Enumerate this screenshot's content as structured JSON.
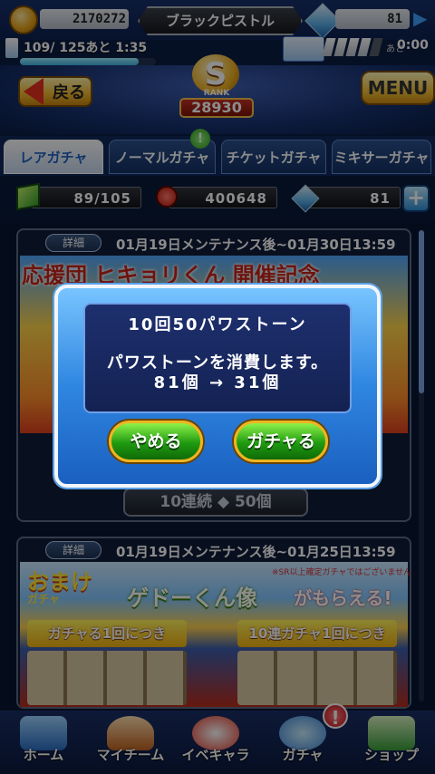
{
  "status": {
    "coins": "2170272",
    "nickname": "ブラックピストル",
    "stones": "81",
    "stamina_text": "109/ 125あと 1:35",
    "stamina_fraction": 0.872,
    "recover_prefix": "あと",
    "recover_time": "0:00",
    "energy_segments_on": 4,
    "energy_segments_total": 5
  },
  "header": {
    "back_label": "戻る",
    "rank_letter": "S",
    "rank_word": "RANK",
    "rank_value": "28930",
    "menu_label": "MENU"
  },
  "tabs": [
    {
      "label": "レアガチャ",
      "active": true
    },
    {
      "label": "ノーマルガチャ",
      "active": false
    },
    {
      "label": "チケットガチャ",
      "active": false
    },
    {
      "label": "ミキサーガチャ",
      "active": false
    }
  ],
  "notice_badge": "!",
  "resources": {
    "material": "89/105",
    "coin": "400648",
    "stone": "81",
    "plus": "+"
  },
  "banners": [
    {
      "detail": "詳細",
      "period": "01月19日メンテナンス後~01月30日13:59",
      "title": "応援団 ヒキョリくん 開催記念",
      "ten_roll": "10連続 ◆ 50個"
    },
    {
      "detail": "詳細",
      "period": "01月19日メンテナンス後~01月25日13:59",
      "omake": "おまけ",
      "gacha": "ガチャ",
      "title": "ゲドーくん像",
      "moraeru": "がもらえる!",
      "note": "※SR以上確定ガチャではございません",
      "box1": "ガチャる1回につき",
      "box2": "10連ガチャ1回につき"
    }
  ],
  "dialog": {
    "title": "10回50パワストーン",
    "line": "パワストーンを消費します。",
    "count": "81個 → 31個",
    "cancel": "やめる",
    "confirm": "ガチャる"
  },
  "nav": {
    "home": "ホーム",
    "team": "マイチーム",
    "event": "イベキャラ",
    "gacha": "ガチャ",
    "shop": "ショップ",
    "gacha_alert": "!"
  },
  "colors": {
    "accent": "#2f86e0",
    "confirm_green": "#1f9a10",
    "alert_red": "#c5101a"
  }
}
